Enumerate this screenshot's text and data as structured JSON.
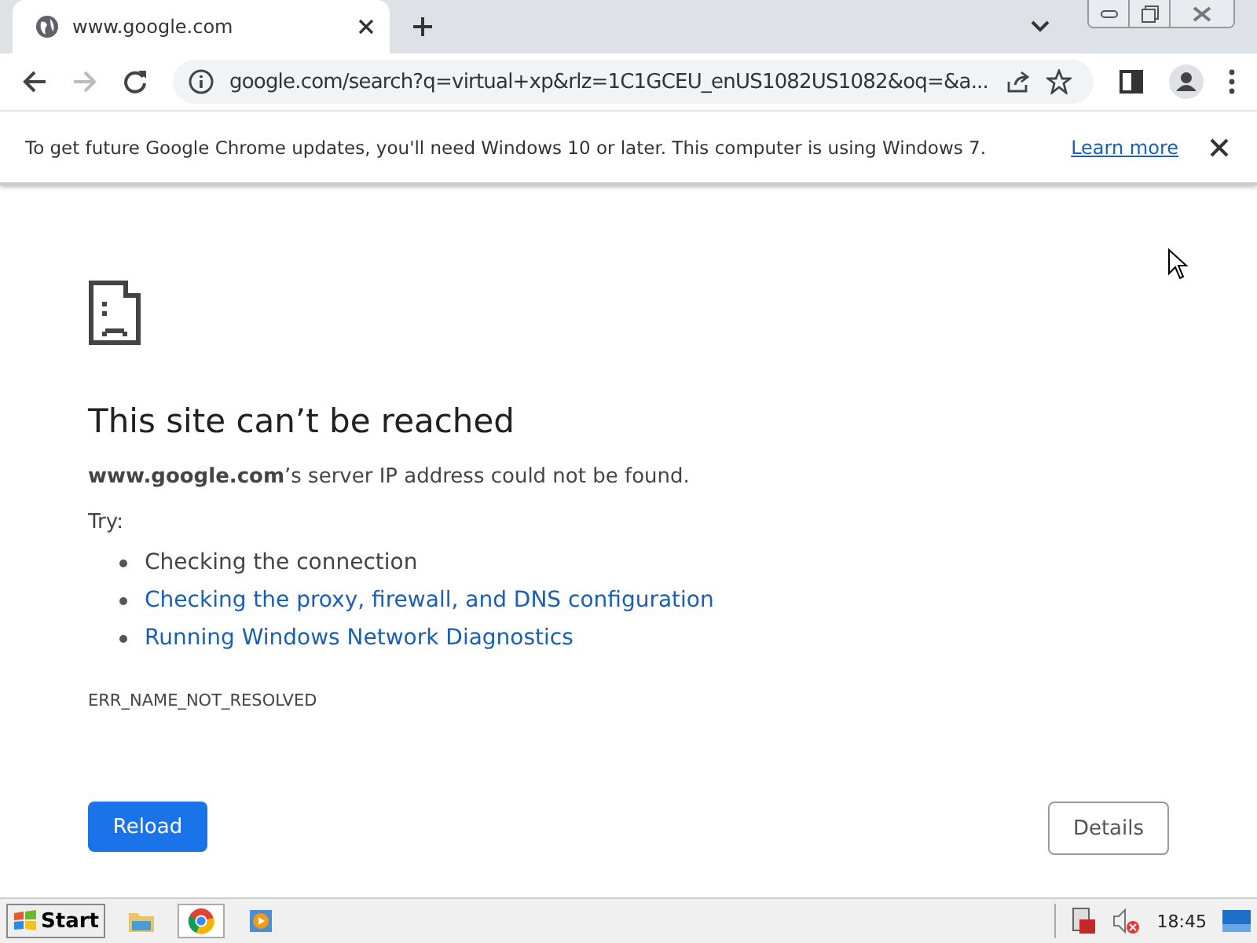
{
  "tabs": [
    {
      "title": "www.google.com",
      "selected": true
    }
  ],
  "address_bar": {
    "url": "google.com/search?q=virtual+xp&rlz=1C1GCEU_enUS1082US1082&oq=&a..."
  },
  "toolbar": {
    "forward_disabled": true
  },
  "infobar": {
    "message": "To get future Google Chrome updates, you'll need Windows 10 or later. This computer is using Windows 7.",
    "link": "Learn more"
  },
  "error": {
    "title": "This site can’t be reached",
    "message": "**www.google.com**’s server IP address could not be found.",
    "try_label": "Try:",
    "suggestions": [
      {
        "kind": "text",
        "text": "Checking the connection"
      },
      {
        "kind": "link",
        "text": "Checking the proxy, firewall, and DNS configuration"
      },
      {
        "kind": "link",
        "text": "Running Windows Network Diagnostics"
      }
    ],
    "code": "ERR_NAME_NOT_RESOLVED",
    "reload": "Reload",
    "details": "Details"
  },
  "taskbar": {
    "start": "Start",
    "apps": [
      {
        "kind": "explorer",
        "selected": false
      },
      {
        "kind": "chrome",
        "selected": true
      },
      {
        "kind": "media",
        "selected": false
      }
    ],
    "clock": "18:45"
  }
}
